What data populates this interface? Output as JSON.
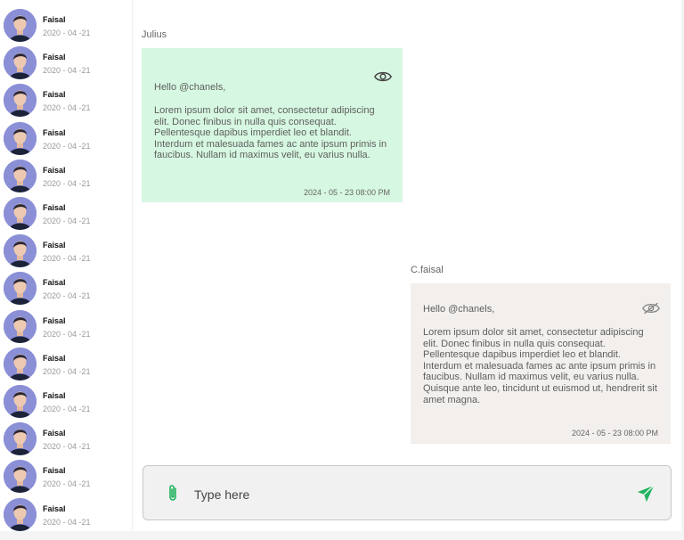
{
  "contacts": [
    {
      "name": "Faisal",
      "date": "2020 - 04 -21"
    },
    {
      "name": "Faisal",
      "date": "2020 - 04 -21"
    },
    {
      "name": "Faisal",
      "date": "2020 - 04 -21"
    },
    {
      "name": "Faisal",
      "date": "2020 - 04 -21"
    },
    {
      "name": "Faisal",
      "date": "2020 - 04 -21"
    },
    {
      "name": "Faisal",
      "date": "2020 - 04 -21"
    },
    {
      "name": "Faisal",
      "date": "2020 - 04 -21"
    },
    {
      "name": "Faisal",
      "date": "2020 - 04 -21"
    },
    {
      "name": "Faisal",
      "date": "2020 - 04 -21"
    },
    {
      "name": "Faisal",
      "date": "2020 - 04 -21"
    },
    {
      "name": "Faisal",
      "date": "2020 - 04 -21"
    },
    {
      "name": "Faisal",
      "date": "2020 - 04 -21"
    },
    {
      "name": "Faisal",
      "date": "2020 - 04 -21"
    },
    {
      "name": "Faisal",
      "date": "2020 - 04 -21"
    }
  ],
  "messages": [
    {
      "sender": "Julius",
      "greeting": "Hello @chanels,",
      "body": "Lorem ipsum dolor sit amet, consectetur adipiscing elit. Donec finibus in nulla quis consequat. Pellentesque dapibus imperdiet leo et blandit. Interdum et malesuada fames ac ante ipsum primis in faucibus. Nullam id maximus velit, eu varius nulla.",
      "timestamp": "2024 - 05 - 23 08:00 PM",
      "icon": "eye-icon"
    },
    {
      "sender": "C.faisal",
      "greeting": "Hello @chanels,",
      "body": "Lorem ipsum dolor sit amet, consectetur adipiscing elit. Donec finibus in nulla quis consequat. Pellentesque dapibus imperdiet leo et blandit. Interdum et malesuada fames ac ante ipsum primis in faucibus. Nullam id maximus velit, eu varius nulla. Quisque ante leo, tincidunt ut euismod ut, hendrerit sit amet magna.",
      "timestamp": "2024 - 05 - 23 08:00 PM",
      "icon": "eye-off-icon"
    }
  ],
  "composer": {
    "placeholder": "Type here",
    "attach_icon": "paperclip-icon",
    "send_icon": "send-icon"
  },
  "colors": {
    "incoming_bubble": "#d6f7e1",
    "outgoing_bubble": "#f2efed",
    "accent_green": "#22b35e",
    "avatar_bg": "#8a8fd6"
  }
}
